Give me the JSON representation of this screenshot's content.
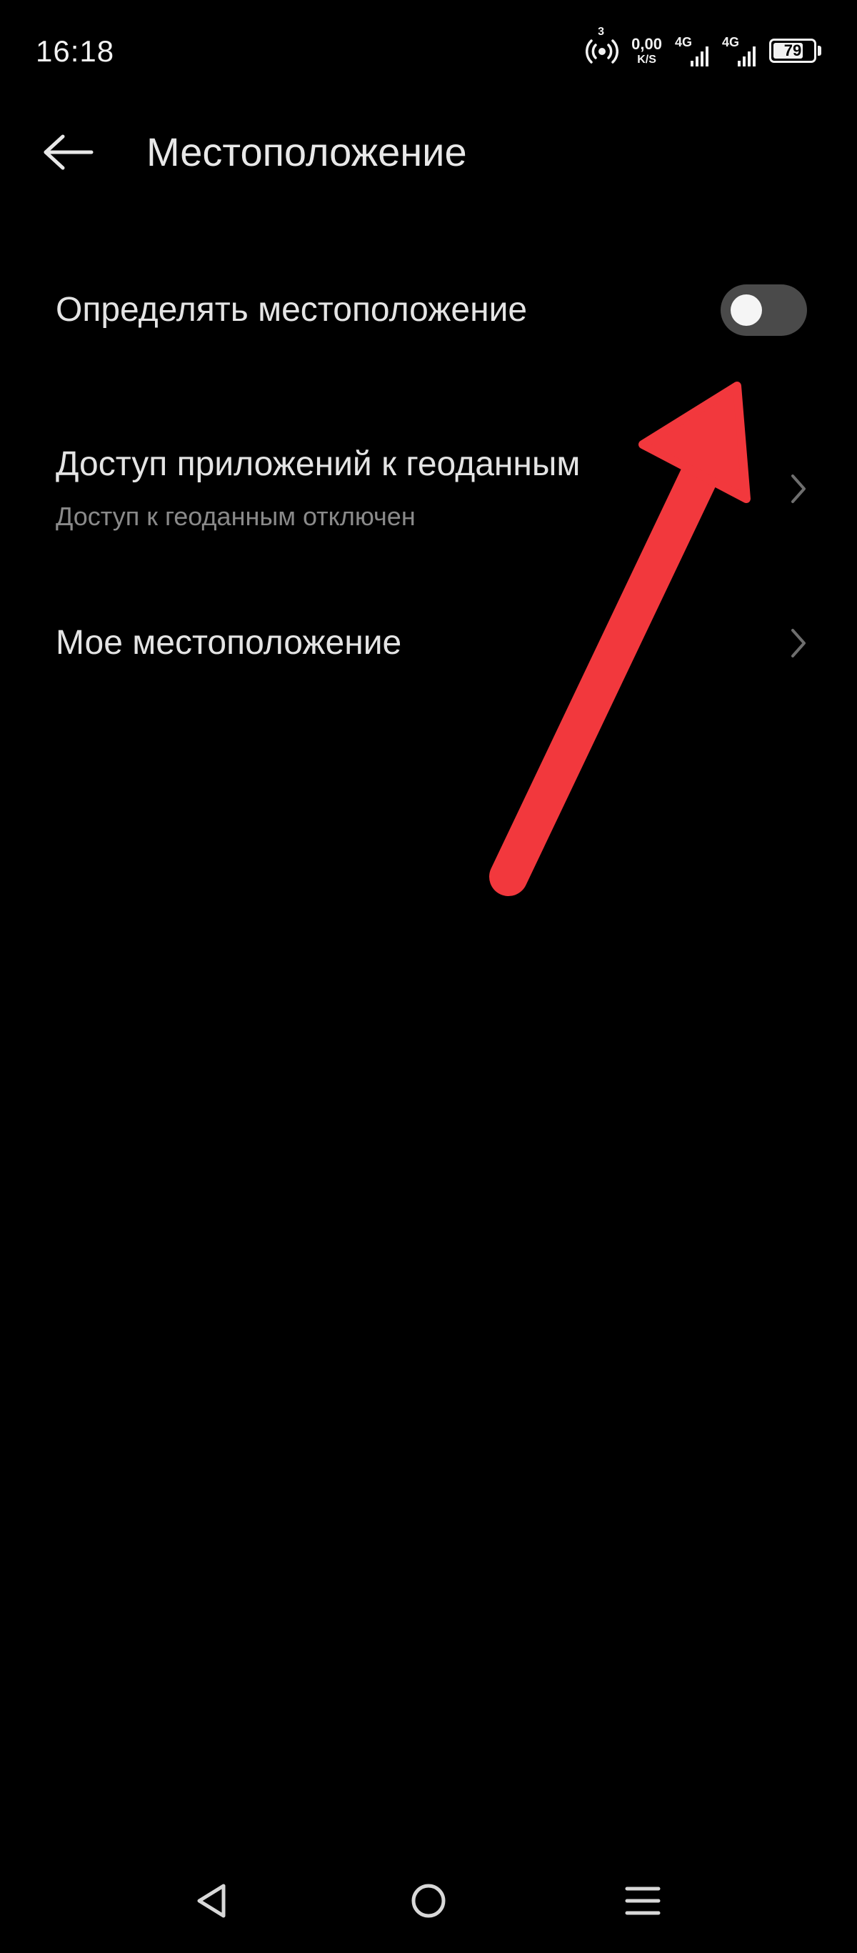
{
  "status_bar": {
    "time": "16:18",
    "hotspot_count": "3",
    "speed_value": "0,00",
    "speed_unit": "K/S",
    "network_1": "4G",
    "network_2": "4G",
    "battery_level": "79",
    "battery_fraction": 0.79
  },
  "header": {
    "back_icon": "arrow-left-icon",
    "title": "Местоположение"
  },
  "settings": {
    "location_toggle": {
      "label": "Определять местоположение",
      "enabled": false
    },
    "app_geodata_access": {
      "label": "Доступ приложений к геоданным",
      "subtitle": "Доступ к геоданным отключен",
      "icon": "chevron-right-icon"
    },
    "my_location": {
      "label": "Мое местоположение",
      "icon": "chevron-right-icon"
    }
  },
  "annotation": {
    "color": "#f2383d",
    "icon": "red-arrow-annotation"
  },
  "nav_bar": {
    "back_icon": "triangle-back-icon",
    "home_icon": "circle-home-icon",
    "menu_icon": "menu-icon"
  },
  "colors": {
    "background": "#000000",
    "text_primary": "#e4e4e4",
    "text_secondary": "#8a8a8a",
    "toggle_track_off": "#4a4a4a"
  }
}
